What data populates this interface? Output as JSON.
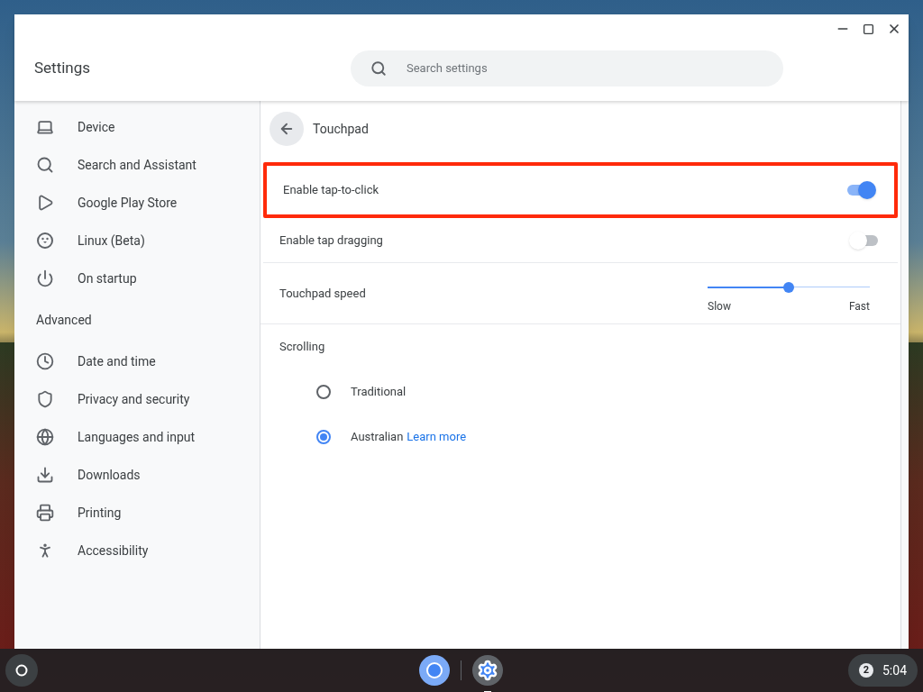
{
  "window": {
    "title": "Settings",
    "search": {
      "placeholder": "Search settings"
    }
  },
  "sidebar": {
    "items": [
      {
        "label": "Device",
        "selected": false
      },
      {
        "label": "Search and Assistant",
        "selected": false
      },
      {
        "label": "Google Play Store",
        "selected": false
      },
      {
        "label": "Linux (Beta)",
        "selected": false
      },
      {
        "label": "On startup",
        "selected": false
      }
    ],
    "section": "Advanced",
    "advanced_items": [
      {
        "label": "Date and time",
        "selected": false
      },
      {
        "label": "Privacy and security",
        "selected": false
      },
      {
        "label": "Languages and input",
        "selected": false
      },
      {
        "label": "Downloads",
        "selected": false
      },
      {
        "label": "Printing",
        "selected": false
      },
      {
        "label": "Accessibility",
        "selected": false
      }
    ]
  },
  "page": {
    "title": "Touchpad",
    "settings": [
      {
        "kind": "toggle",
        "label": "Enable tap-to-click",
        "on": true,
        "highlighted": true
      },
      {
        "kind": "toggle",
        "label": "Enable tap dragging",
        "on": false,
        "highlighted": false
      },
      {
        "kind": "slider",
        "label": "Touchpad speed",
        "level": 0.5,
        "min_label": "Slow",
        "max_label": "Fast"
      }
    ],
    "scrolling": {
      "label": "Scrolling",
      "options": [
        {
          "label": "Traditional",
          "selected": false
        },
        {
          "label": "Australian",
          "selected": true,
          "link": "Learn more"
        }
      ]
    }
  },
  "shelf": {
    "notification_count": "2",
    "time": "5:04"
  }
}
